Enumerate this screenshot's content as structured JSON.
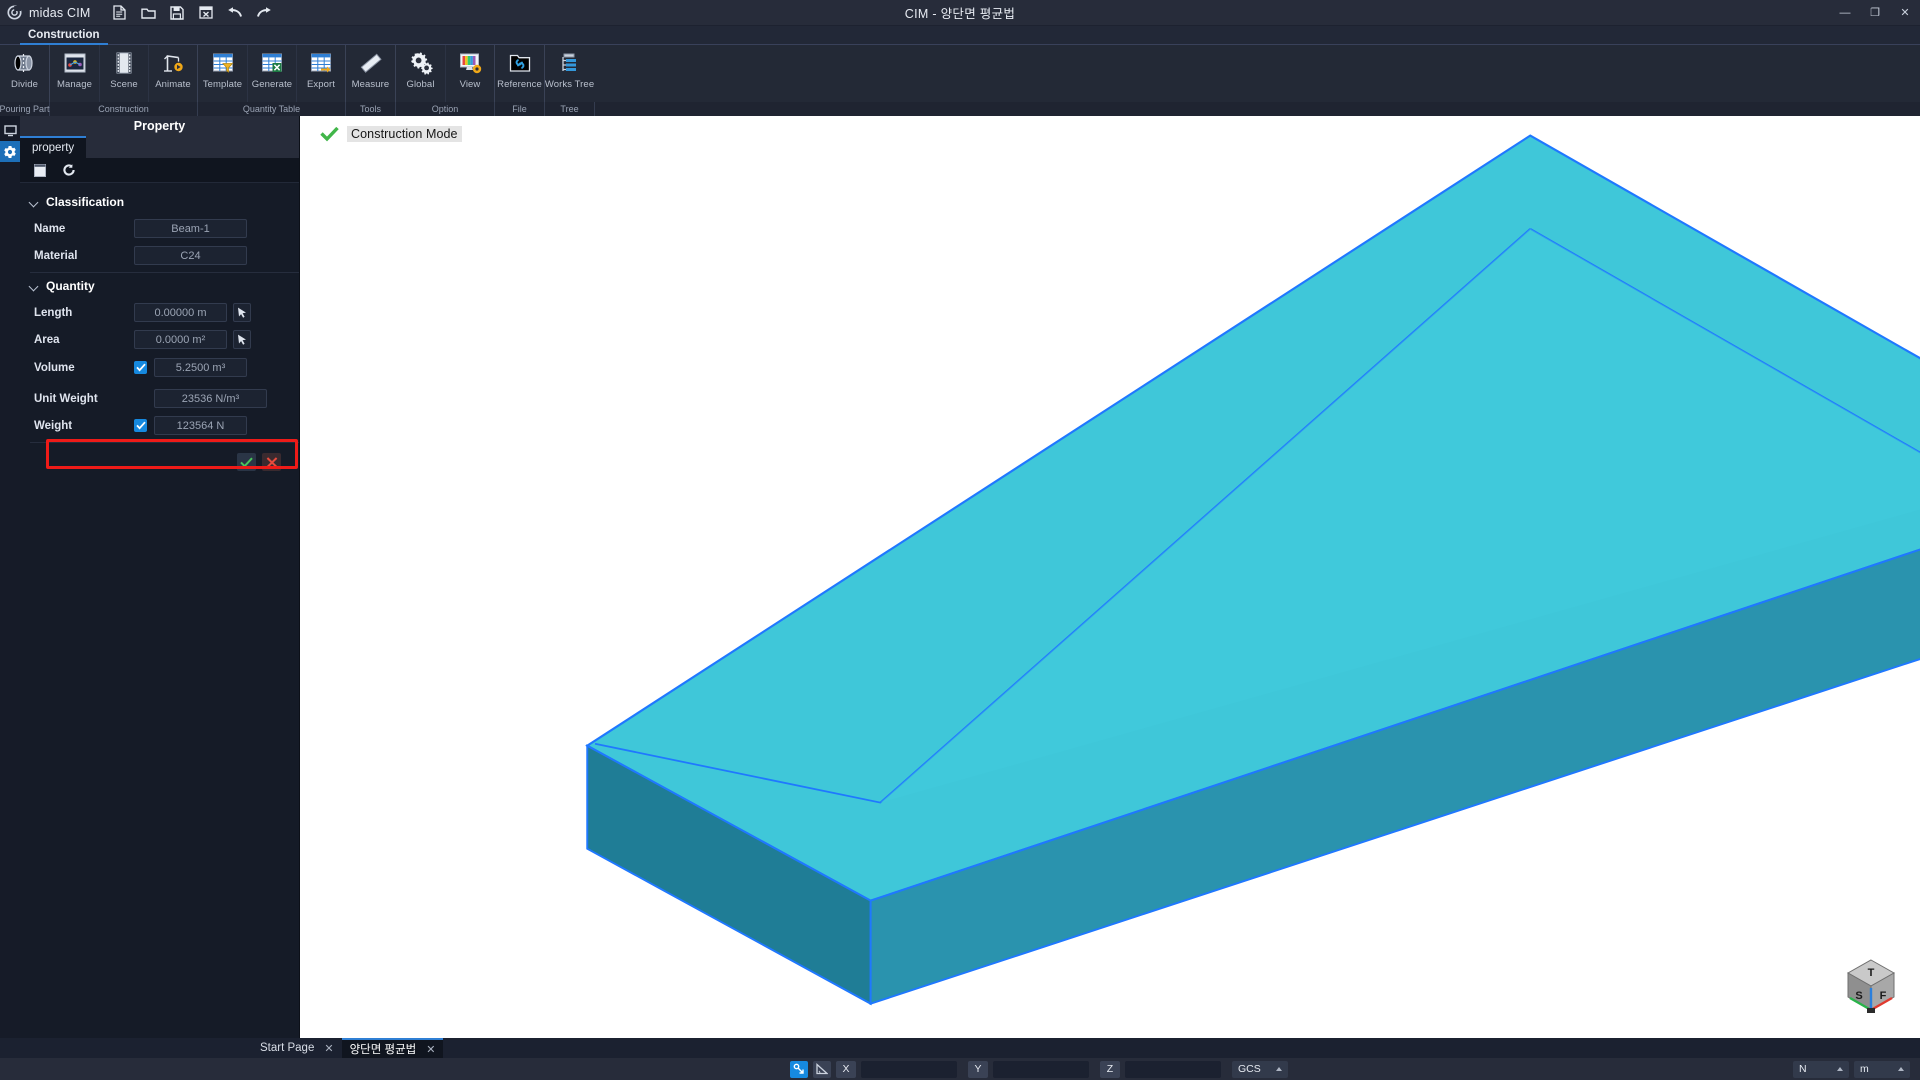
{
  "titlebar": {
    "brand": "midas CIM",
    "window_title": "CIM - 양단면 평균법",
    "quick_access": [
      {
        "name": "new-file-icon",
        "label": "New"
      },
      {
        "name": "open-folder-icon",
        "label": "Open"
      },
      {
        "name": "save-icon",
        "label": "Save"
      },
      {
        "name": "close-document-icon",
        "label": "Close"
      },
      {
        "name": "undo-icon",
        "label": "Undo"
      },
      {
        "name": "redo-icon",
        "label": "Redo"
      }
    ],
    "window_controls": {
      "minimize": "—",
      "restore": "❐",
      "close": "✕"
    }
  },
  "ribbon": {
    "tabs": [
      {
        "label": "Construction",
        "active": true
      }
    ],
    "buttons": [
      {
        "label": "Divide",
        "icon": "divide-icon"
      },
      {
        "label": "Manage",
        "icon": "manage-icon"
      },
      {
        "label": "Scene",
        "icon": "scene-icon"
      },
      {
        "label": "Animate",
        "icon": "animate-icon"
      },
      {
        "label": "Template",
        "icon": "template-icon"
      },
      {
        "label": "Generate",
        "icon": "generate-icon"
      },
      {
        "label": "Export",
        "icon": "export-icon"
      },
      {
        "label": "Measure",
        "icon": "measure-icon"
      },
      {
        "label": "Global",
        "icon": "global-icon"
      },
      {
        "label": "View",
        "icon": "view-icon"
      },
      {
        "label": "Reference",
        "icon": "reference-icon"
      },
      {
        "label": "Works Tree",
        "icon": "works-tree-icon"
      }
    ],
    "group_labels": [
      "Pouring Part",
      "Construction",
      "Quantity Table",
      "Tools",
      "Option",
      "File",
      "Tree"
    ]
  },
  "rail": {
    "items": [
      {
        "name": "display-icon",
        "active": false
      },
      {
        "name": "property-gear-icon",
        "active": true
      }
    ]
  },
  "panel": {
    "title": "Property",
    "tab": "property",
    "toolbar": [
      {
        "name": "table-icon",
        "selected": true
      },
      {
        "name": "refresh-icon",
        "selected": false
      }
    ],
    "sections": [
      {
        "title": "Classification",
        "rows": [
          {
            "label": "Name",
            "value": "Beam-1",
            "checkbox": null,
            "picker": false
          },
          {
            "label": "Material",
            "value": "C24",
            "checkbox": null,
            "picker": false
          }
        ]
      },
      {
        "title": "Quantity",
        "rows": [
          {
            "label": "Length",
            "value": "0.00000 m",
            "checkbox": null,
            "picker": true
          },
          {
            "label": "Area",
            "value": "0.0000 m²",
            "checkbox": null,
            "picker": true
          },
          {
            "label": "Volume",
            "value": "5.2500 m³",
            "checkbox": true,
            "picker": false,
            "highlighted": true
          },
          {
            "label": "Unit Weight",
            "value": "23536 N/m³",
            "checkbox": null,
            "picker": false
          },
          {
            "label": "Weight",
            "value": "123564 N",
            "checkbox": true,
            "picker": false
          }
        ]
      }
    ],
    "actions": [
      {
        "name": "apply-button",
        "glyph": "check"
      },
      {
        "name": "cancel-button",
        "glyph": "cross"
      }
    ]
  },
  "viewport": {
    "construction_mode_label": "Construction Mode",
    "model": {
      "face_top_color": "#3fc7d9",
      "face_side_color": "#1f7d96",
      "face_front_color": "#2a93ae",
      "edge_color": "#1f78ff"
    },
    "viewcube": {
      "top_face": "T",
      "left_face": "S",
      "right_face": "F"
    }
  },
  "doc_tabs": [
    {
      "label": "Start Page",
      "active": false,
      "closable": true
    },
    {
      "label": "양단면 평균법",
      "active": true,
      "closable": true
    }
  ],
  "statusbar": {
    "snap_toggle": {
      "name": "snap-point-icon",
      "on": true
    },
    "angle_toggle": {
      "name": "snap-angle-icon",
      "on": false
    },
    "coords": [
      {
        "axis": "X",
        "value": ""
      },
      {
        "axis": "Y",
        "value": ""
      },
      {
        "axis": "Z",
        "value": ""
      }
    ],
    "coord_system": "GCS",
    "force_unit": "N",
    "length_unit": "m"
  },
  "colors": {
    "accent": "#1689df",
    "highlight_red": "#ee1b18",
    "model_cyan": "#3fc7d9",
    "panel_bg": "#151b27",
    "titlebar_bg": "#272c3a"
  }
}
